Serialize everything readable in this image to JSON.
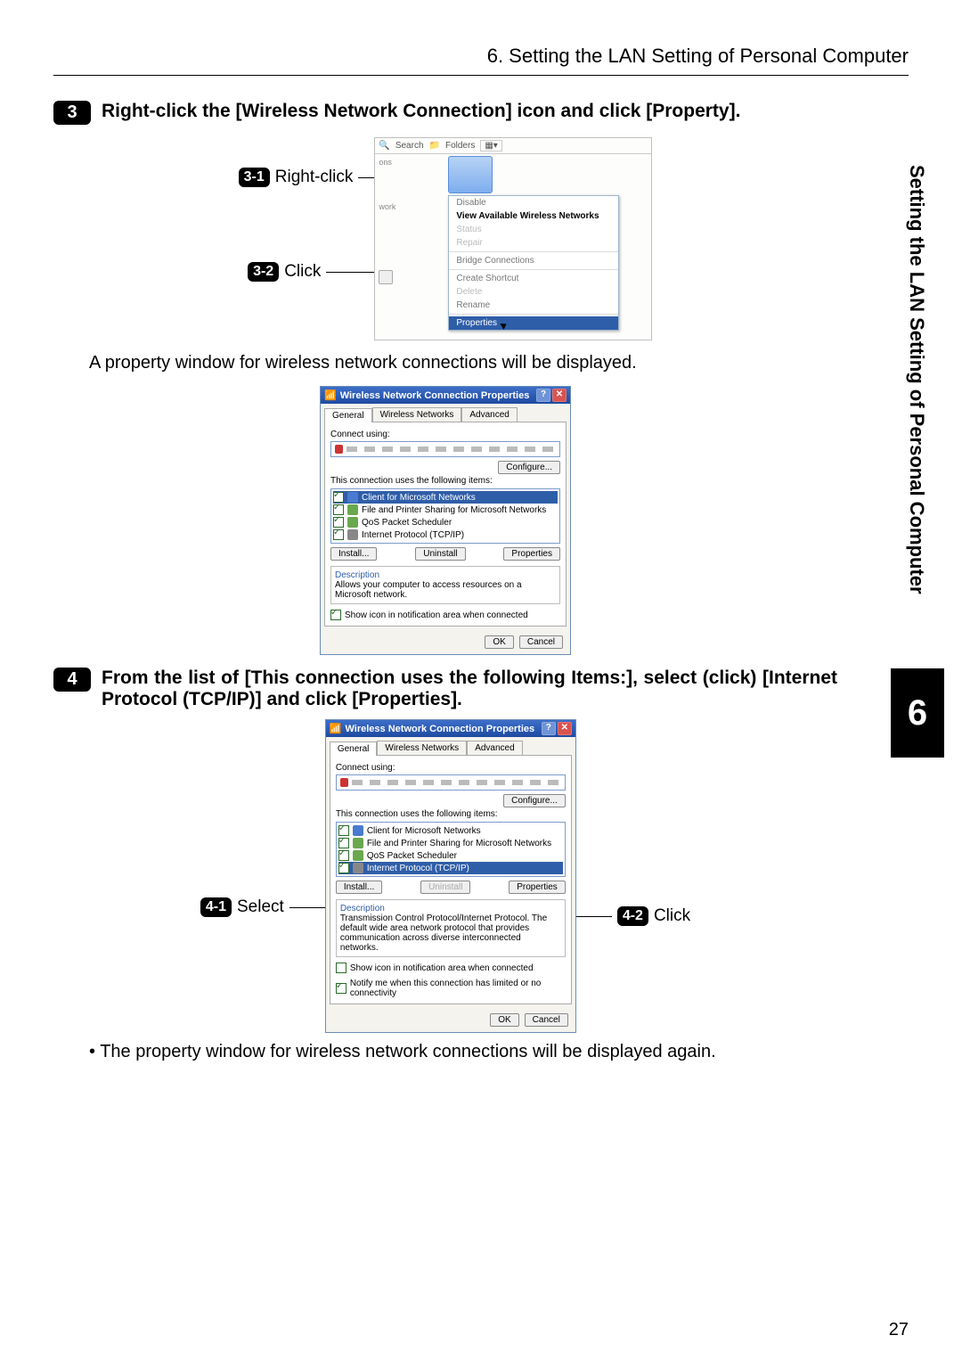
{
  "header": {
    "title": "6. Setting the LAN Setting of Personal Computer"
  },
  "sideTab": "Setting the LAN Setting of Personal Computer",
  "chapter": "6",
  "pageNumber": "27",
  "step3": {
    "badge": "3",
    "text": "Right-click the [Wireless Network Connection] icon and click [Property].",
    "sub1": {
      "badge": "3-1",
      "label": "Right-click"
    },
    "sub2": {
      "badge": "3-2",
      "label": "Click"
    },
    "afterText": "A property window for wireless network connections will be displayed."
  },
  "step4": {
    "badge": "4",
    "text": "From the list of [This connection uses the following Items:], select (click) [Internet Protocol (TCP/IP)] and click [Properties].",
    "sub1": {
      "badge": "4-1",
      "label": "Select"
    },
    "sub2": {
      "badge": "4-2",
      "label": "Click"
    },
    "afterText": "The property window for wireless network connections will be displayed again."
  },
  "fig1": {
    "toolbar": {
      "search": "Search",
      "folders": "Folders"
    },
    "left": {
      "top": "ons",
      "bottom": "work"
    },
    "ctx": {
      "disable": "Disable",
      "view": "View Available Wireless Networks",
      "status": "Status",
      "repair": "Repair",
      "bridge": "Bridge Connections",
      "shortcut": "Create Shortcut",
      "delete": "Delete",
      "rename": "Rename",
      "properties": "Properties"
    }
  },
  "propdlg": {
    "title": "Wireless Network Connection Properties",
    "tabs": {
      "general": "General",
      "wireless": "Wireless Networks",
      "advanced": "Advanced"
    },
    "connectUsing": "Connect using:",
    "configure": "Configure...",
    "listLabel": "This connection uses the following items:",
    "items": {
      "client": "Client for Microsoft Networks",
      "fileShare": "File and Printer Sharing for Microsoft Networks",
      "qos": "QoS Packet Scheduler",
      "tcpip": "Internet Protocol (TCP/IP)"
    },
    "install": "Install...",
    "uninstall": "Uninstall",
    "properties": "Properties",
    "descTitle": "Description",
    "desc1": "Allows your computer to access resources on a Microsoft network.",
    "desc2": "Transmission Control Protocol/Internet Protocol. The default wide area network protocol that provides communication across diverse interconnected networks.",
    "showIcon": "Show icon in notification area when connected",
    "notify": "Notify me when this connection has limited or no connectivity",
    "ok": "OK",
    "cancel": "Cancel"
  }
}
